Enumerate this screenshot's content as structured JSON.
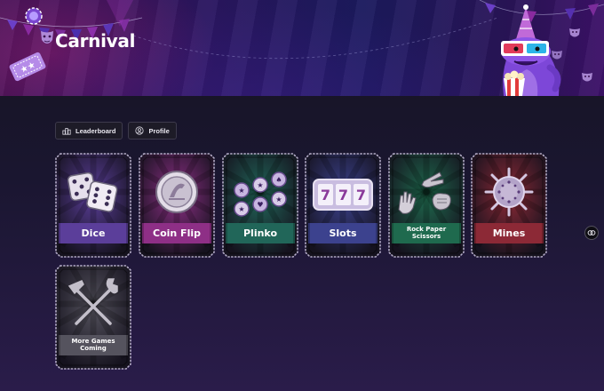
{
  "header": {
    "title": "Carnival"
  },
  "toolbar": {
    "leaderboard_label": "Leaderboard",
    "profile_label": "Profile"
  },
  "games": [
    {
      "label": "Dice",
      "color": "#5b3e9a"
    },
    {
      "label": "Coin Flip",
      "color": "#8e2f86"
    },
    {
      "label": "Plinko",
      "color": "#216659"
    },
    {
      "label": "Slots",
      "color": "#3c428e"
    },
    {
      "label": "Rock Paper Scissors",
      "color": "#1f6a4e"
    },
    {
      "label": "Mines",
      "color": "#8c2936"
    },
    {
      "label": "More Games Coming",
      "color": "#55535e"
    }
  ],
  "icons": {
    "leaderboard": "podium-icon",
    "profile": "user-circle-icon",
    "floating": "game-controller-icon"
  }
}
